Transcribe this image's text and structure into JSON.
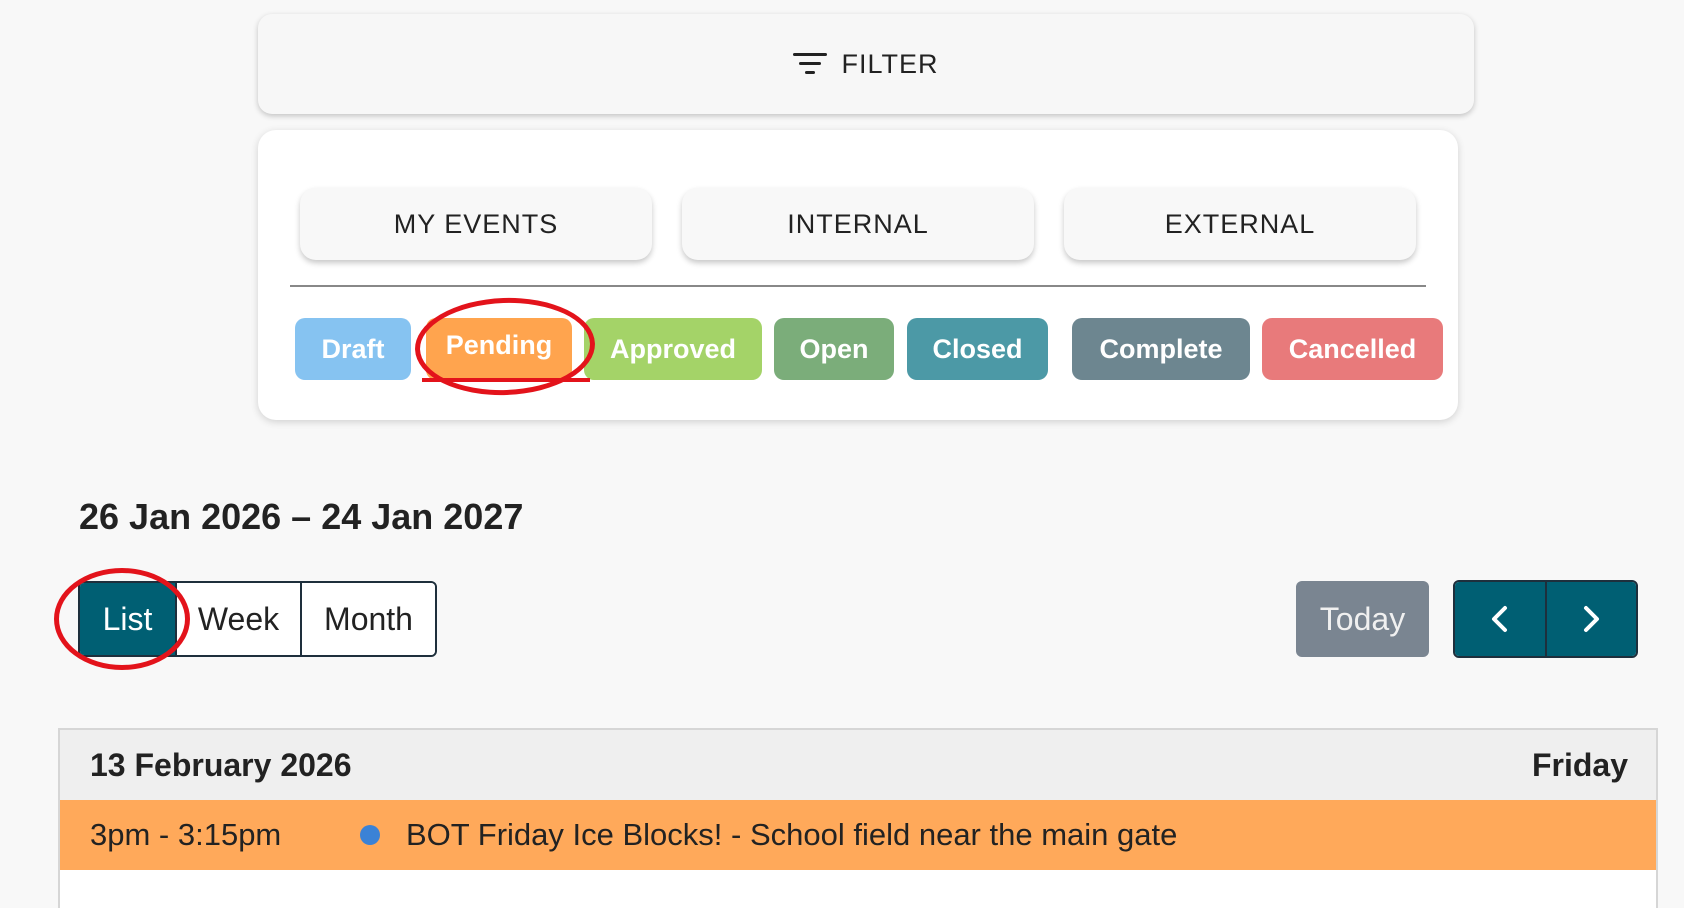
{
  "filter_bar": {
    "label": "FILTER",
    "icon": "filter-icon"
  },
  "segments": [
    {
      "label": "MY EVENTS"
    },
    {
      "label": "INTERNAL"
    },
    {
      "label": "EXTERNAL"
    }
  ],
  "status_chips": [
    {
      "label": "Draft",
      "color": "#86c3f1"
    },
    {
      "label": "Pending",
      "color": "#ffa44e",
      "highlighted": true
    },
    {
      "label": "Approved",
      "color": "#a4d368"
    },
    {
      "label": "Open",
      "color": "#7bad7a"
    },
    {
      "label": "Closed",
      "color": "#4c99a6"
    },
    {
      "label": "Complete",
      "color": "#6d8690"
    },
    {
      "label": "Cancelled",
      "color": "#e87a7b"
    }
  ],
  "date_range": "26 Jan 2026 – 24 Jan 2027",
  "views": [
    {
      "label": "List",
      "active": true
    },
    {
      "label": "Week",
      "active": false
    },
    {
      "label": "Month",
      "active": false
    }
  ],
  "navigation": {
    "today_label": "Today",
    "prev_icon": "chevron-left-icon",
    "next_icon": "chevron-right-icon"
  },
  "list": {
    "day": {
      "date": "13 February 2026",
      "weekday": "Friday"
    },
    "events": [
      {
        "time": "3pm - 3:15pm",
        "title": "BOT Friday Ice Blocks! - School field near the main gate",
        "dot_color": "#3b82d6",
        "row_color": "#ffa95a"
      }
    ]
  },
  "colors": {
    "accent": "#005f73",
    "annotation": "#e3131b"
  }
}
